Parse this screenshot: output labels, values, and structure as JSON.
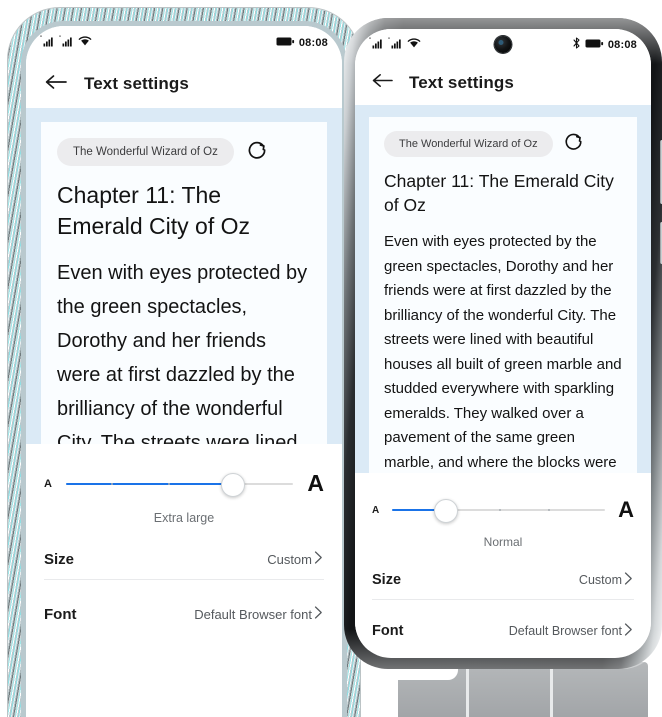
{
  "phones": {
    "left": {
      "status_bar": {
        "signal_icons": [
          "signal-bars-sim1-icon",
          "signal-bars-sim2-icon"
        ],
        "wifi_icon": "wifi-icon",
        "battery_icon": "battery-icon",
        "time": "08:08"
      },
      "app_bar": {
        "back_icon": "back-arrow-icon",
        "title": "Text settings"
      },
      "preview": {
        "url_text": "The Wonderful Wizard of Oz",
        "reload_icon": "reload-icon",
        "heading": "Chapter 11: The Emerald City of Oz",
        "body": "Even with eyes protected by the green spectacles, Dorothy and her friends were at first dazzled by the brilliancy of the wonderful City. The streets were lined with beautiful houses all"
      },
      "slider": {
        "small_a": "A",
        "large_a": "A",
        "label": "Extra large",
        "fill_percent": 73,
        "tick_percents": [
          20,
          45,
          73
        ]
      },
      "rows": [
        {
          "label": "Size",
          "value": "Custom"
        },
        {
          "label": "Font",
          "value": "Default Browser font"
        }
      ]
    },
    "right": {
      "status_bar": {
        "signal_icons": [
          "signal-bars-sim1-icon",
          "signal-bars-sim2-icon"
        ],
        "wifi_icon": "wifi-icon",
        "bluetooth_icon": "bluetooth-icon",
        "battery_icon": "battery-icon",
        "time": "08:08",
        "camera": "front-camera-punch-hole"
      },
      "app_bar": {
        "back_icon": "back-arrow-icon",
        "title": "Text settings"
      },
      "preview": {
        "url_text": "The Wonderful Wizard of Oz",
        "reload_icon": "reload-icon",
        "heading": "Chapter 11: The Emerald City of Oz",
        "body": "Even with eyes protected by the green spectacles, Dorothy and her friends were at first dazzled by the brilliancy of the wonderful City. The streets were lined with beautiful houses all built of green marble and studded everywhere with sparkling emeralds. They walked over a pavement of the same green marble, and where the blocks were joined"
      },
      "slider": {
        "small_a": "A",
        "large_a": "A",
        "label": "Normal",
        "fill_percent": 25,
        "tick_percents": [
          25,
          50,
          73
        ]
      },
      "rows": [
        {
          "label": "Size",
          "value": "Custom"
        },
        {
          "label": "Font",
          "value": "Default Browser font"
        }
      ]
    }
  },
  "colors": {
    "accent": "#1a73e8",
    "preview_backdrop": "#dbeaf6",
    "card": "#fafdff",
    "pill": "#ececee"
  },
  "chevron_glyph": "›"
}
